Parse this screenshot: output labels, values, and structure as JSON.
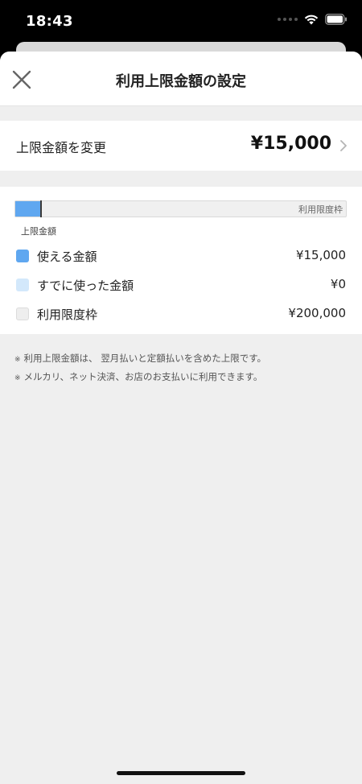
{
  "status_bar": {
    "time": "18:43"
  },
  "header": {
    "title": "利用上限金額の設定"
  },
  "limit": {
    "label": "上限金額を変更",
    "value": "¥15,000"
  },
  "usage": {
    "bar_end_label": "利用限度枠",
    "marker_label": "上限金額",
    "available_fraction": 0.075,
    "limit_fraction": 0.075,
    "legend": [
      {
        "label": "使える金額",
        "value": "¥15,000",
        "color": "#5fa7f0"
      },
      {
        "label": "すでに使った金額",
        "value": "¥0",
        "color": "#d3e8fb"
      },
      {
        "label": "利用限度枠",
        "value": "¥200,000",
        "color": "#eeeeee"
      }
    ]
  },
  "notes": {
    "mark": "※",
    "lines": [
      "利用上限金額は、 翌月払いと定額払いを含めた上限です。",
      "メルカリ、ネット決済、お店のお支払いに利用できます。"
    ]
  },
  "colors": {
    "accent": "#5fa7f0",
    "background": "#efefef"
  }
}
